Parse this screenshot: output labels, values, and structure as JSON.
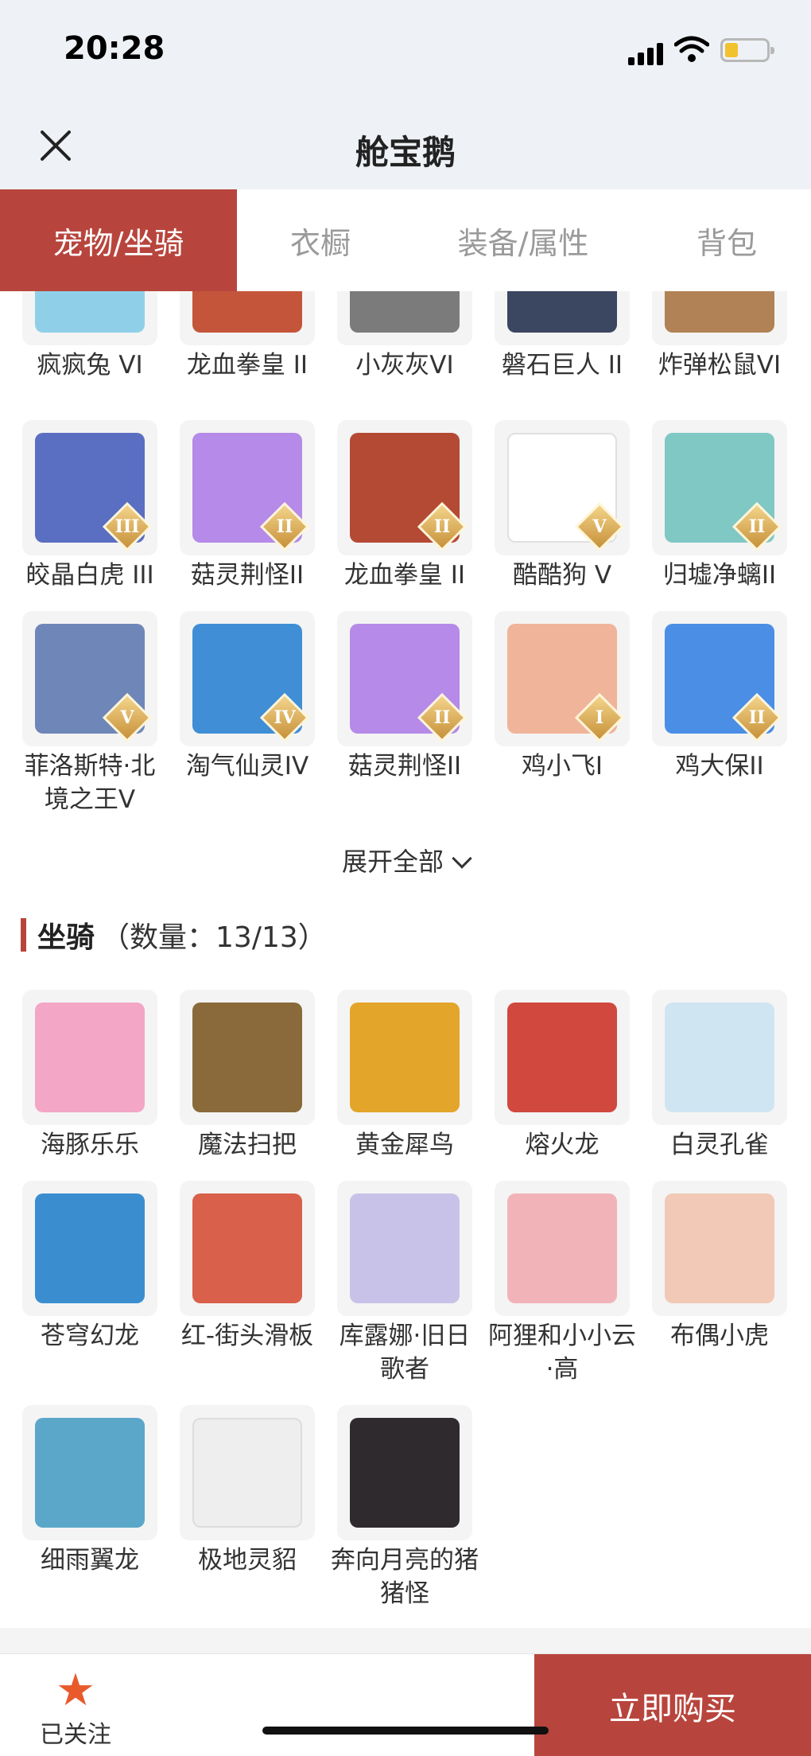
{
  "status": {
    "time": "20:28"
  },
  "header": {
    "title": "舱宝鹅"
  },
  "tabs": [
    "宠物/坐骑",
    "衣橱",
    "装备/属性",
    "背包"
  ],
  "pets": {
    "row0": [
      {
        "name": "疯疯兔 VI",
        "color": "#8fd0e8"
      },
      {
        "name": "龙血拳皇 II",
        "color": "#c4553a"
      },
      {
        "name": "小灰灰VI",
        "color": "#7b7b7b"
      },
      {
        "name": "磐石巨人 II",
        "color": "#3b4660"
      },
      {
        "name": "炸弹松鼠VI",
        "color": "#b08255"
      }
    ],
    "row1": [
      {
        "name": "皎晶白虎 III",
        "tier": "III",
        "color": "#5a6fc2"
      },
      {
        "name": "菇灵荆怪II",
        "tier": "II",
        "color": "#b58ae8"
      },
      {
        "name": "龙血拳皇 II",
        "tier": "II",
        "color": "#b54a34"
      },
      {
        "name": "酷酷狗 V",
        "tier": "V",
        "color": "#ffffff"
      },
      {
        "name": "归墟净螭II",
        "tier": "II",
        "color": "#7fc8c4"
      }
    ],
    "row2": [
      {
        "name": "菲洛斯特·北境之王V",
        "tier": "V",
        "color": "#6f86b8"
      },
      {
        "name": "淘气仙灵IV",
        "tier": "IV",
        "color": "#3f8ed6"
      },
      {
        "name": "菇灵荆怪II",
        "tier": "II",
        "color": "#b58ae8"
      },
      {
        "name": "鸡小飞I",
        "tier": "I",
        "color": "#f0b49a"
      },
      {
        "name": "鸡大保II",
        "tier": "II",
        "color": "#4a8ee6"
      }
    ]
  },
  "expand_all": "展开全部",
  "mounts_section": {
    "title": "坐骑",
    "count": "（数量：13/13）"
  },
  "mounts": {
    "row0": [
      {
        "name": "海豚乐乐",
        "color": "#f4a6c6"
      },
      {
        "name": "魔法扫把",
        "color": "#8a6a3a"
      },
      {
        "name": "黄金犀鸟",
        "color": "#e3a52a"
      },
      {
        "name": "熔火龙",
        "color": "#d0483e"
      },
      {
        "name": "白灵孔雀",
        "color": "#cfe6f2"
      }
    ],
    "row1": [
      {
        "name": "苍穹幻龙",
        "color": "#3a8ed0"
      },
      {
        "name": "红-街头滑板",
        "color": "#d9604a"
      },
      {
        "name": "库露娜·旧日歌者",
        "color": "#c9c2e8"
      },
      {
        "name": "阿狸和小小云·高",
        "color": "#f2b3b8"
      },
      {
        "name": "布偶小虎",
        "color": "#f1c9b6"
      }
    ],
    "row2": [
      {
        "name": "细雨翼龙",
        "color": "#5aa7c9"
      },
      {
        "name": "极地灵貂",
        "color": "#eeeeee"
      },
      {
        "name": "奔向月亮的猪猪怪",
        "color": "#2f2a2e"
      }
    ]
  },
  "bottom": {
    "follow_label": "已关注",
    "buy_label": "立即购买"
  }
}
